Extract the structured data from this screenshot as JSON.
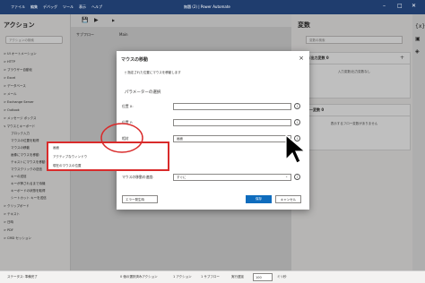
{
  "titlebar": {
    "menu": [
      "ファイル",
      "編集",
      "デバッグ",
      "ツール",
      "表示",
      "ヘルプ"
    ],
    "title": "無題 (2) | Power Automate"
  },
  "actions": {
    "title": "アクション",
    "search_placeholder": "アクションの検索",
    "items": [
      "> UI オートメーション",
      "> HTTP",
      "> ブラウザー自動化",
      "> Excel",
      "> データベース",
      "> メール",
      "> Exchange Server",
      "> Outlook",
      "> メッセージ ボックス",
      "∨ マウスとキーボード",
      "ブロック入力",
      "マウスの位置を取得",
      "マウスの移動",
      "画像にマウスを移動",
      "テキストにマウスを移動",
      "マウスクリックの送信",
      "キーの送信",
      "キーが押されるまで待機",
      "キーボードの状態を取得",
      "シートカット キーを送信",
      "> クリップボード",
      "> テキスト",
      "> 日時",
      "> PDF",
      "> CMD セッション"
    ]
  },
  "center": {
    "tab": "Main",
    "subflow": "サブフロー"
  },
  "variables": {
    "title": "変数",
    "search_placeholder": "変数の検索",
    "input_output": "入力/出力変数",
    "input_output_count": "0",
    "input_output_empty": "入力変数/出力変数なし",
    "flow_vars": "フロー変数",
    "flow_vars_count": "0",
    "flow_vars_empty": "表示するフロー変数がありません"
  },
  "status": {
    "text": "ステータス: 準備完了",
    "selected": "0 個の選択済みアクション",
    "actions": "1 アクション",
    "subflows": "1 サブフロー",
    "delay": "実行遅延",
    "delay_value": "100",
    "unit": "ミリ秒"
  },
  "dialog": {
    "title": "マウスの移動",
    "description": "指定された位置にマウスを移動します",
    "params_header": "パラメーターの選択",
    "x_label": "位置 X:",
    "y_label": "位置 Y:",
    "relative_label": "相対",
    "move_label": "マウスの移動の速度:",
    "relative_value": "画面",
    "dropdown_options": [
      "画面",
      "アクティブなウィンドウ",
      "現在のマウスの位置"
    ],
    "speed_value": "すぐに",
    "error_button": "エラー発生時",
    "save": "保存",
    "cancel": "キャンセル"
  },
  "colors": {
    "accent": "#0f6cbd",
    "highlight": "#d92b2b",
    "titlebar": "#1f3d6e"
  }
}
